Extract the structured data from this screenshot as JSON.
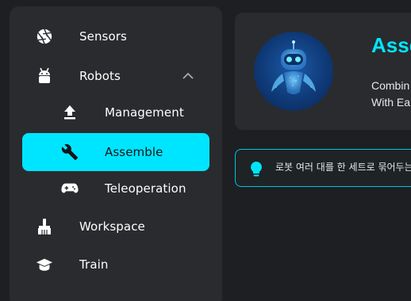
{
  "colors": {
    "accent": "#00e5ff",
    "sidebar_bg": "#2a2b2e",
    "page_bg": "#1e1f22"
  },
  "sidebar": {
    "items": [
      {
        "label": "Sensors",
        "icon": "aperture-icon",
        "level": "top"
      },
      {
        "label": "Robots",
        "icon": "android-icon",
        "level": "top",
        "expanded": true
      },
      {
        "label": "Management",
        "icon": "upload-icon",
        "level": "sub"
      },
      {
        "label": "Assemble",
        "icon": "wrench-icon",
        "level": "sub",
        "active": true
      },
      {
        "label": "Teleoperation",
        "icon": "gamepad-icon",
        "level": "sub"
      },
      {
        "label": "Workspace",
        "icon": "broom-icon",
        "level": "top"
      },
      {
        "label": "Train",
        "icon": "graduation-cap-icon",
        "level": "top"
      }
    ]
  },
  "card": {
    "title": "Asse",
    "desc_line1": "Combin",
    "desc_line2": "With Ea",
    "avatar_icon": "robot-icon"
  },
  "tip": {
    "icon": "lightbulb-icon",
    "text": "로봇 여러 대를 한 세트로 묶어두는"
  }
}
